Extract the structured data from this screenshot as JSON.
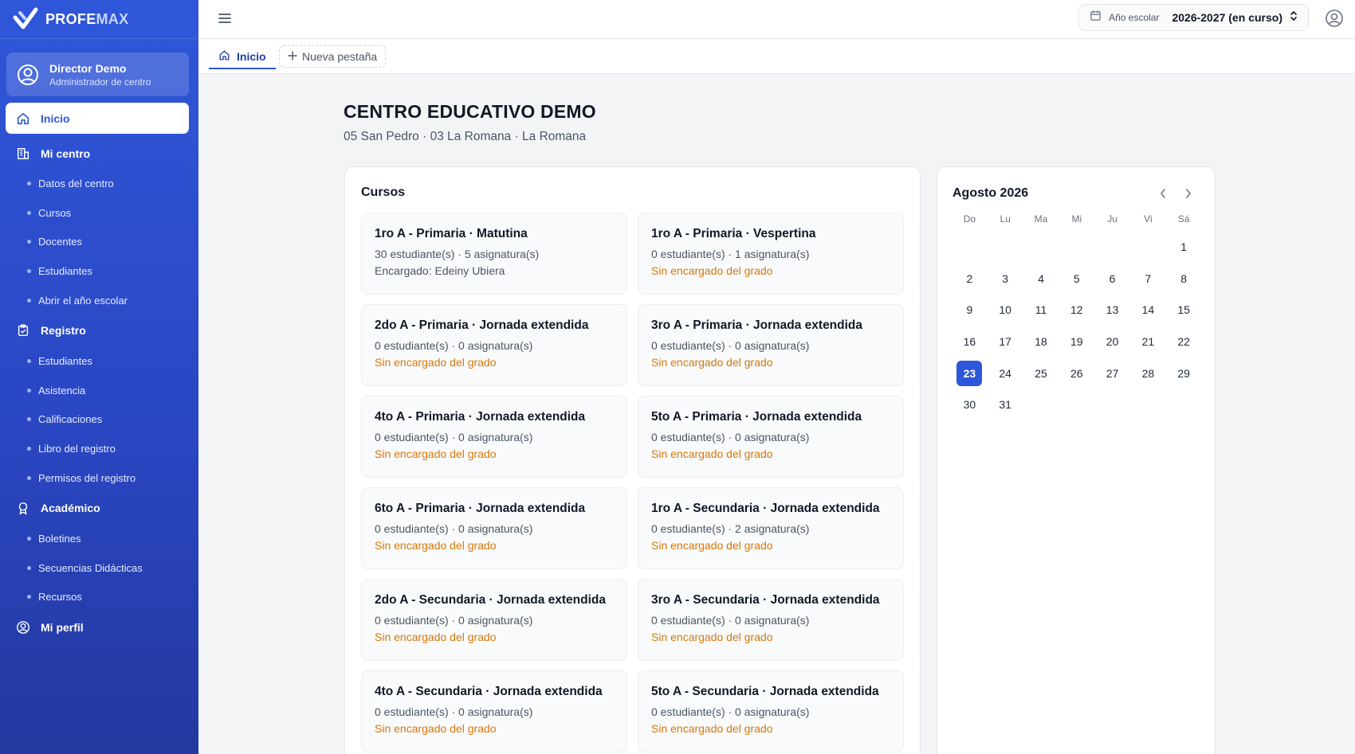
{
  "brand": {
    "name_a": "PROFE",
    "name_b": "MAX"
  },
  "user": {
    "name": "Director Demo",
    "role": "Administrador de centro"
  },
  "sidebar": {
    "home": "Inicio",
    "mi_centro": {
      "label": "Mi centro",
      "items": [
        "Datos del centro",
        "Cursos",
        "Docentes",
        "Estudiantes",
        "Abrir el año escolar"
      ]
    },
    "registro": {
      "label": "Registro",
      "items": [
        "Estudiantes",
        "Asistencia",
        "Calificaciones",
        "Libro del registro",
        "Permisos del registro"
      ]
    },
    "academico": {
      "label": "Académico",
      "items": [
        "Boletines",
        "Secuencias Didácticas",
        "Recursos"
      ]
    },
    "perfil": "Mi perfil"
  },
  "topbar": {
    "year_label": "Año escolar",
    "year_value": "2026-2027 (en curso)"
  },
  "tabs": {
    "home": "Inicio",
    "new": "Nueva pestaña"
  },
  "school": {
    "name": "CENTRO EDUCATIVO DEMO",
    "location": "05 San Pedro · 03 La Romana · La Romana"
  },
  "courses": {
    "title": "Cursos",
    "items": [
      {
        "name": "1ro A - Primaria · Matutina",
        "stats": "30 estudiante(s) · 5 asignatura(s)",
        "teacher": "Encargado: Edeiny Ubiera",
        "assigned": true
      },
      {
        "name": "1ro A - Primaria · Vespertina",
        "stats": "0 estudiante(s) · 1 asignatura(s)",
        "teacher": "Sin encargado del grado",
        "assigned": false
      },
      {
        "name": "2do A - Primaria · Jornada extendida",
        "stats": "0 estudiante(s) · 0 asignatura(s)",
        "teacher": "Sin encargado del grado",
        "assigned": false
      },
      {
        "name": "3ro A - Primaria · Jornada extendida",
        "stats": "0 estudiante(s) · 0 asignatura(s)",
        "teacher": "Sin encargado del grado",
        "assigned": false
      },
      {
        "name": "4to A - Primaria · Jornada extendida",
        "stats": "0 estudiante(s) · 0 asignatura(s)",
        "teacher": "Sin encargado del grado",
        "assigned": false
      },
      {
        "name": "5to A - Primaria · Jornada extendida",
        "stats": "0 estudiante(s) · 0 asignatura(s)",
        "teacher": "Sin encargado del grado",
        "assigned": false
      },
      {
        "name": "6to A - Primaria · Jornada extendida",
        "stats": "0 estudiante(s) · 0 asignatura(s)",
        "teacher": "Sin encargado del grado",
        "assigned": false
      },
      {
        "name": "1ro A - Secundaria · Jornada extendida",
        "stats": "0 estudiante(s) · 2 asignatura(s)",
        "teacher": "Sin encargado del grado",
        "assigned": false
      },
      {
        "name": "2do A - Secundaria · Jornada extendida",
        "stats": "0 estudiante(s) · 0 asignatura(s)",
        "teacher": "Sin encargado del grado",
        "assigned": false
      },
      {
        "name": "3ro A - Secundaria · Jornada extendida",
        "stats": "0 estudiante(s) · 0 asignatura(s)",
        "teacher": "Sin encargado del grado",
        "assigned": false
      },
      {
        "name": "4to A - Secundaria · Jornada extendida",
        "stats": "0 estudiante(s) · 0 asignatura(s)",
        "teacher": "Sin encargado del grado",
        "assigned": false
      },
      {
        "name": "5to A - Secundaria · Jornada extendida",
        "stats": "0 estudiante(s) · 0 asignatura(s)",
        "teacher": "Sin encargado del grado",
        "assigned": false
      }
    ]
  },
  "calendar": {
    "title": "Agosto 2026",
    "weekdays": [
      "Do",
      "Lu",
      "Ma",
      "Mi",
      "Ju",
      "Vi",
      "Sá"
    ],
    "days": [
      "",
      "",
      "",
      "",
      "",
      "",
      "1",
      "2",
      "3",
      "4",
      "5",
      "6",
      "7",
      "8",
      "9",
      "10",
      "11",
      "12",
      "13",
      "14",
      "15",
      "16",
      "17",
      "18",
      "19",
      "20",
      "21",
      "22",
      "23",
      "24",
      "25",
      "26",
      "27",
      "28",
      "29",
      "30",
      "31"
    ],
    "today": "23"
  },
  "colors": {
    "primary": "#2f57d9",
    "warning": "#d97706"
  }
}
